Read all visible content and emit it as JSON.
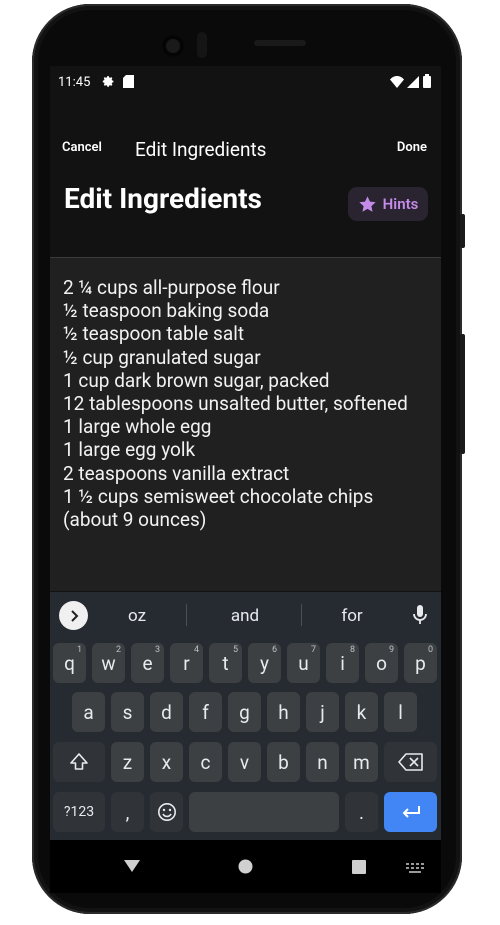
{
  "status_bar": {
    "time": "11:45",
    "icons": [
      "gear-icon",
      "sim-card-icon",
      "wifi-icon",
      "signal-icon",
      "battery-icon"
    ]
  },
  "app_bar": {
    "cancel": "Cancel",
    "title": "Edit Ingredients",
    "done": "Done"
  },
  "header": {
    "title": "Edit Ingredients",
    "hints_label": "Hints",
    "hints_icon": "star-icon",
    "accent": "#c58be8"
  },
  "editor": {
    "text": "2 ¼ cups all-purpose flour\n½ teaspoon baking soda\n½ teaspoon table salt\n½ cup granulated sugar\n1 cup dark brown sugar, packed\n12 tablespoons unsalted butter, softened\n1 large whole egg\n1 large egg yolk\n2 teaspoons vanilla extract\n1 ½ cups semisweet chocolate chips (about 9 ounces)"
  },
  "keyboard": {
    "suggestions": [
      "oz",
      "and",
      "for"
    ],
    "row1": [
      {
        "k": "q",
        "n": "1"
      },
      {
        "k": "w",
        "n": "2"
      },
      {
        "k": "e",
        "n": "3"
      },
      {
        "k": "r",
        "n": "4"
      },
      {
        "k": "t",
        "n": "5"
      },
      {
        "k": "y",
        "n": "6"
      },
      {
        "k": "u",
        "n": "7"
      },
      {
        "k": "i",
        "n": "8"
      },
      {
        "k": "o",
        "n": "9"
      },
      {
        "k": "p",
        "n": "0"
      }
    ],
    "row2": [
      "a",
      "s",
      "d",
      "f",
      "g",
      "h",
      "j",
      "k",
      "l"
    ],
    "row3": [
      "z",
      "x",
      "c",
      "v",
      "b",
      "n",
      "m"
    ],
    "symbols": "?123",
    "comma": ",",
    "period": ".",
    "emoji_icon": "emoji-icon",
    "shift_icon": "shift-icon",
    "backspace_icon": "backspace-icon",
    "enter_icon": "enter-icon",
    "enter_color": "#4285f4"
  },
  "nav_bar": {
    "icons": [
      "back-icon",
      "home-icon",
      "recents-icon",
      "keyboard-switch-icon"
    ]
  }
}
